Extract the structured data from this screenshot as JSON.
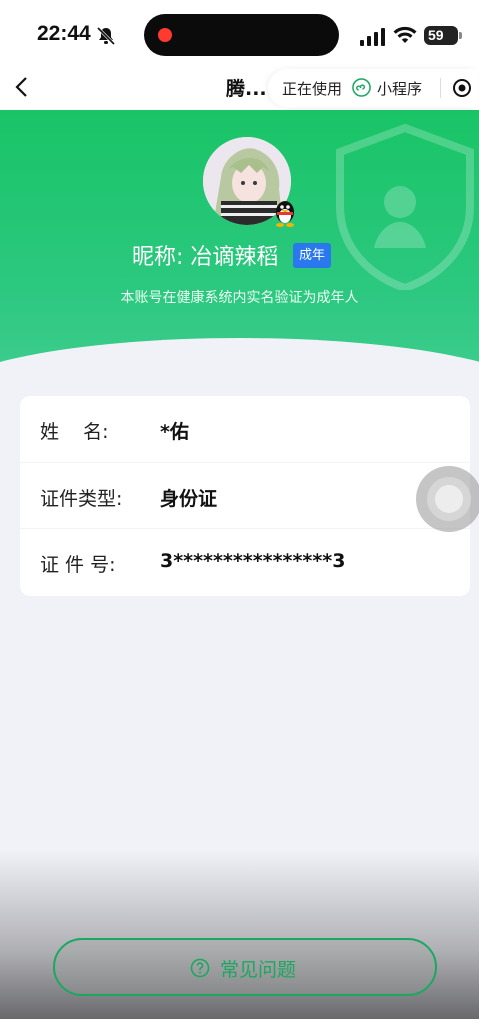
{
  "status_bar": {
    "time": "22:44",
    "battery": "59"
  },
  "nav": {
    "title": "腾...",
    "capsule_using": "正在使用",
    "capsule_miniprogram": "小程序"
  },
  "profile": {
    "nickname": "昵称: 冶谪辣稻",
    "badge": "成年",
    "verify_note": "本账号在健康系统内实名验证为成年人"
  },
  "info": {
    "rows": [
      {
        "label": "姓    名:",
        "value": "*佑"
      },
      {
        "label": "证件类型:",
        "value": "身份证"
      },
      {
        "label": "证 件 号:",
        "value": "3****************3"
      }
    ]
  },
  "footer": {
    "faq_label": "常见问题"
  },
  "colors": {
    "brand_green": "#19c466",
    "badge_blue": "#2a78ee",
    "background": "#f1f2f7"
  }
}
